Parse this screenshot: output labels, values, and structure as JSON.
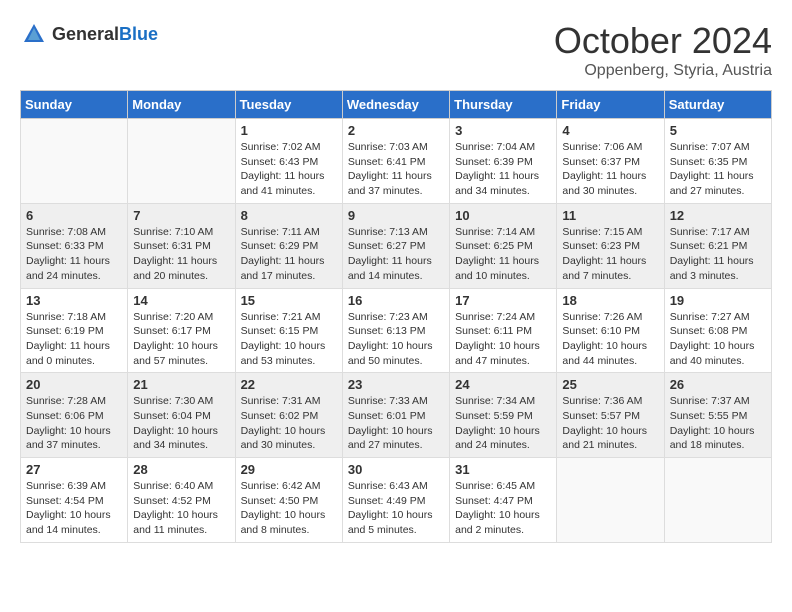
{
  "logo": {
    "general": "General",
    "blue": "Blue"
  },
  "title": "October 2024",
  "subtitle": "Oppenberg, Styria, Austria",
  "weekdays": [
    "Sunday",
    "Monday",
    "Tuesday",
    "Wednesday",
    "Thursday",
    "Friday",
    "Saturday"
  ],
  "weeks": [
    [
      {
        "day": "",
        "sunrise": "",
        "sunset": "",
        "daylight": ""
      },
      {
        "day": "",
        "sunrise": "",
        "sunset": "",
        "daylight": ""
      },
      {
        "day": "1",
        "sunrise": "Sunrise: 7:02 AM",
        "sunset": "Sunset: 6:43 PM",
        "daylight": "Daylight: 11 hours and 41 minutes."
      },
      {
        "day": "2",
        "sunrise": "Sunrise: 7:03 AM",
        "sunset": "Sunset: 6:41 PM",
        "daylight": "Daylight: 11 hours and 37 minutes."
      },
      {
        "day": "3",
        "sunrise": "Sunrise: 7:04 AM",
        "sunset": "Sunset: 6:39 PM",
        "daylight": "Daylight: 11 hours and 34 minutes."
      },
      {
        "day": "4",
        "sunrise": "Sunrise: 7:06 AM",
        "sunset": "Sunset: 6:37 PM",
        "daylight": "Daylight: 11 hours and 30 minutes."
      },
      {
        "day": "5",
        "sunrise": "Sunrise: 7:07 AM",
        "sunset": "Sunset: 6:35 PM",
        "daylight": "Daylight: 11 hours and 27 minutes."
      }
    ],
    [
      {
        "day": "6",
        "sunrise": "Sunrise: 7:08 AM",
        "sunset": "Sunset: 6:33 PM",
        "daylight": "Daylight: 11 hours and 24 minutes."
      },
      {
        "day": "7",
        "sunrise": "Sunrise: 7:10 AM",
        "sunset": "Sunset: 6:31 PM",
        "daylight": "Daylight: 11 hours and 20 minutes."
      },
      {
        "day": "8",
        "sunrise": "Sunrise: 7:11 AM",
        "sunset": "Sunset: 6:29 PM",
        "daylight": "Daylight: 11 hours and 17 minutes."
      },
      {
        "day": "9",
        "sunrise": "Sunrise: 7:13 AM",
        "sunset": "Sunset: 6:27 PM",
        "daylight": "Daylight: 11 hours and 14 minutes."
      },
      {
        "day": "10",
        "sunrise": "Sunrise: 7:14 AM",
        "sunset": "Sunset: 6:25 PM",
        "daylight": "Daylight: 11 hours and 10 minutes."
      },
      {
        "day": "11",
        "sunrise": "Sunrise: 7:15 AM",
        "sunset": "Sunset: 6:23 PM",
        "daylight": "Daylight: 11 hours and 7 minutes."
      },
      {
        "day": "12",
        "sunrise": "Sunrise: 7:17 AM",
        "sunset": "Sunset: 6:21 PM",
        "daylight": "Daylight: 11 hours and 3 minutes."
      }
    ],
    [
      {
        "day": "13",
        "sunrise": "Sunrise: 7:18 AM",
        "sunset": "Sunset: 6:19 PM",
        "daylight": "Daylight: 11 hours and 0 minutes."
      },
      {
        "day": "14",
        "sunrise": "Sunrise: 7:20 AM",
        "sunset": "Sunset: 6:17 PM",
        "daylight": "Daylight: 10 hours and 57 minutes."
      },
      {
        "day": "15",
        "sunrise": "Sunrise: 7:21 AM",
        "sunset": "Sunset: 6:15 PM",
        "daylight": "Daylight: 10 hours and 53 minutes."
      },
      {
        "day": "16",
        "sunrise": "Sunrise: 7:23 AM",
        "sunset": "Sunset: 6:13 PM",
        "daylight": "Daylight: 10 hours and 50 minutes."
      },
      {
        "day": "17",
        "sunrise": "Sunrise: 7:24 AM",
        "sunset": "Sunset: 6:11 PM",
        "daylight": "Daylight: 10 hours and 47 minutes."
      },
      {
        "day": "18",
        "sunrise": "Sunrise: 7:26 AM",
        "sunset": "Sunset: 6:10 PM",
        "daylight": "Daylight: 10 hours and 44 minutes."
      },
      {
        "day": "19",
        "sunrise": "Sunrise: 7:27 AM",
        "sunset": "Sunset: 6:08 PM",
        "daylight": "Daylight: 10 hours and 40 minutes."
      }
    ],
    [
      {
        "day": "20",
        "sunrise": "Sunrise: 7:28 AM",
        "sunset": "Sunset: 6:06 PM",
        "daylight": "Daylight: 10 hours and 37 minutes."
      },
      {
        "day": "21",
        "sunrise": "Sunrise: 7:30 AM",
        "sunset": "Sunset: 6:04 PM",
        "daylight": "Daylight: 10 hours and 34 minutes."
      },
      {
        "day": "22",
        "sunrise": "Sunrise: 7:31 AM",
        "sunset": "Sunset: 6:02 PM",
        "daylight": "Daylight: 10 hours and 30 minutes."
      },
      {
        "day": "23",
        "sunrise": "Sunrise: 7:33 AM",
        "sunset": "Sunset: 6:01 PM",
        "daylight": "Daylight: 10 hours and 27 minutes."
      },
      {
        "day": "24",
        "sunrise": "Sunrise: 7:34 AM",
        "sunset": "Sunset: 5:59 PM",
        "daylight": "Daylight: 10 hours and 24 minutes."
      },
      {
        "day": "25",
        "sunrise": "Sunrise: 7:36 AM",
        "sunset": "Sunset: 5:57 PM",
        "daylight": "Daylight: 10 hours and 21 minutes."
      },
      {
        "day": "26",
        "sunrise": "Sunrise: 7:37 AM",
        "sunset": "Sunset: 5:55 PM",
        "daylight": "Daylight: 10 hours and 18 minutes."
      }
    ],
    [
      {
        "day": "27",
        "sunrise": "Sunrise: 6:39 AM",
        "sunset": "Sunset: 4:54 PM",
        "daylight": "Daylight: 10 hours and 14 minutes."
      },
      {
        "day": "28",
        "sunrise": "Sunrise: 6:40 AM",
        "sunset": "Sunset: 4:52 PM",
        "daylight": "Daylight: 10 hours and 11 minutes."
      },
      {
        "day": "29",
        "sunrise": "Sunrise: 6:42 AM",
        "sunset": "Sunset: 4:50 PM",
        "daylight": "Daylight: 10 hours and 8 minutes."
      },
      {
        "day": "30",
        "sunrise": "Sunrise: 6:43 AM",
        "sunset": "Sunset: 4:49 PM",
        "daylight": "Daylight: 10 hours and 5 minutes."
      },
      {
        "day": "31",
        "sunrise": "Sunrise: 6:45 AM",
        "sunset": "Sunset: 4:47 PM",
        "daylight": "Daylight: 10 hours and 2 minutes."
      },
      {
        "day": "",
        "sunrise": "",
        "sunset": "",
        "daylight": ""
      },
      {
        "day": "",
        "sunrise": "",
        "sunset": "",
        "daylight": ""
      }
    ]
  ]
}
